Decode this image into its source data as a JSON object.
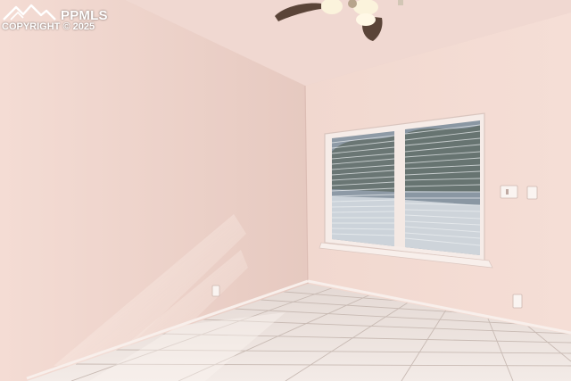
{
  "watermark": {
    "brand": "PPMLS",
    "copyright": "COPYRIGHT © 2025",
    "logo_icon": "mountain-logo-icon"
  },
  "scene": {
    "fixtures": [
      "ceiling-fan",
      "window-with-blinds",
      "light-switch",
      "wall-outlet",
      "tile-floor"
    ],
    "colors": {
      "wall_left": "#efd5cd",
      "wall_right": "#f2d8cf",
      "ceiling": "#f0d9d2",
      "floor": "#efe6e1",
      "trim": "#f7ece7"
    }
  }
}
